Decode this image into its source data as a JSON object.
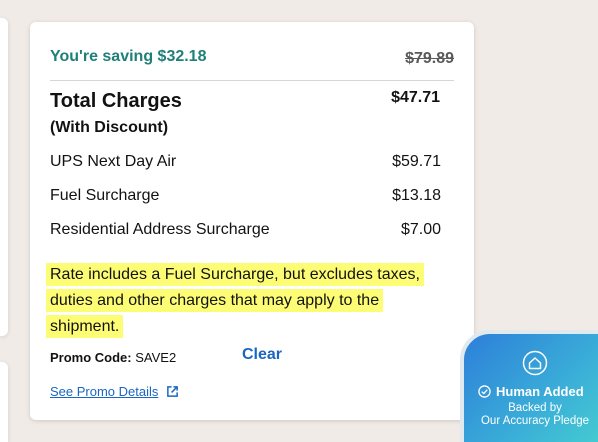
{
  "summary": {
    "savings_text": "You're saving $32.18",
    "original_price": "$79.89",
    "total_label": "Total Charges",
    "total_sublabel": "(With Discount)",
    "total_value": "$47.71"
  },
  "line_items": [
    {
      "label": "UPS Next Day Air",
      "value": "$59.71"
    },
    {
      "label": "Fuel Surcharge",
      "value": "$13.18"
    },
    {
      "label": "Residential Address Surcharge",
      "value": "$7.00"
    }
  ],
  "note": {
    "line1": "Rate includes a Fuel Surcharge, but excludes taxes,",
    "line2": "duties and other charges that may apply to the shipment."
  },
  "promo": {
    "label": "Promo Code:",
    "code": "SAVE2",
    "clear_label": "Clear",
    "details_link": "See Promo Details"
  },
  "badge": {
    "icon": "shield-home-icon",
    "title": "Human Added",
    "line1": "Backed by",
    "line2": "Our Accuracy Pledge"
  },
  "colors": {
    "savings_green": "#1f8077",
    "link_blue": "#1a66c2",
    "highlight_yellow": "#fdfc75",
    "background": "#f0ebe6"
  }
}
